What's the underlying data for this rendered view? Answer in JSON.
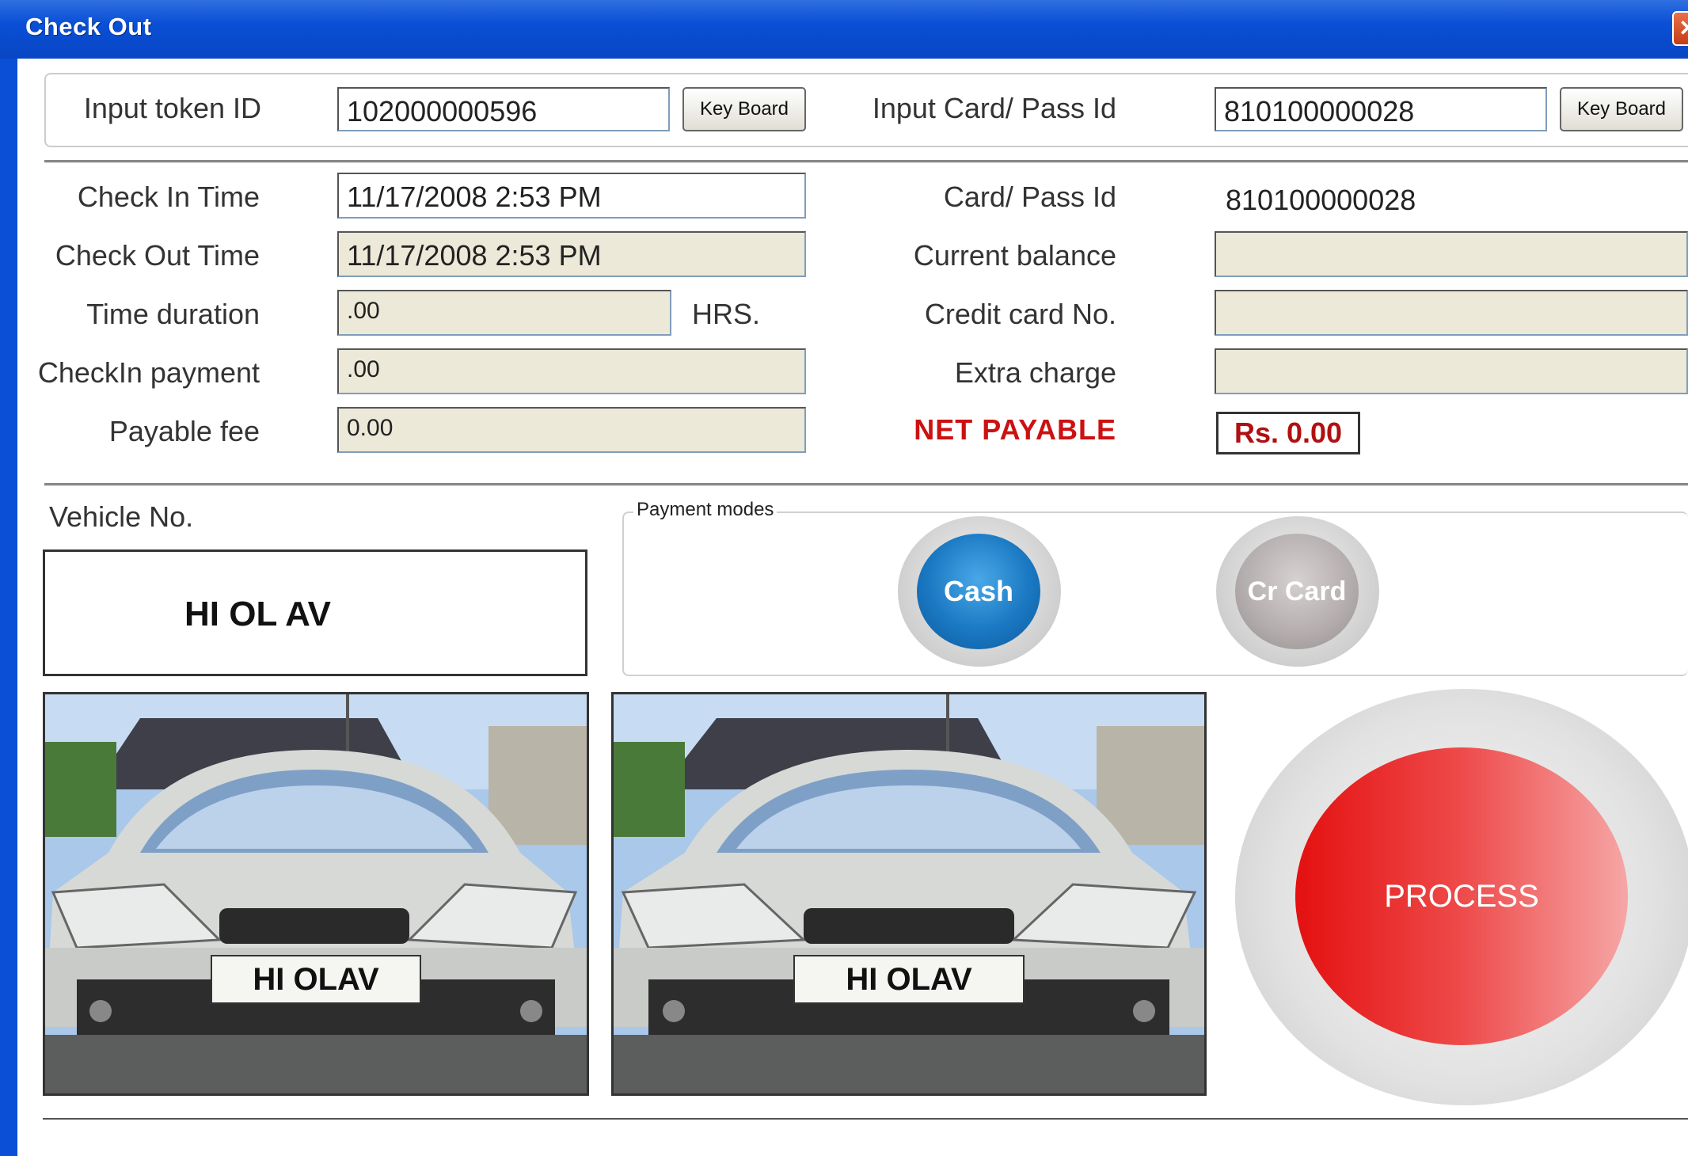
{
  "window": {
    "title": "Check Out",
    "close_glyph": "✕"
  },
  "top": {
    "token_label": "Input token ID",
    "token_value": "102000000596",
    "keyboard_label": "Key Board",
    "card_label": "Input Card/ Pass Id",
    "card_value": "810100000028",
    "keyboard2_label": "Key Board"
  },
  "details": {
    "checkin_time_label": "Check In Time",
    "checkin_time_value": "11/17/2008 2:53 PM",
    "checkout_time_label": "Check Out Time",
    "checkout_time_value": "11/17/2008 2:53 PM",
    "duration_label": "Time duration",
    "duration_value": ".00",
    "duration_unit": "HRS.",
    "checkin_payment_label": "CheckIn payment",
    "checkin_payment_value": ".00",
    "payable_fee_label": "Payable fee",
    "payable_fee_value": "0.00",
    "card_pass_label": "Card/ Pass Id",
    "card_pass_value": "810100000028",
    "current_balance_label": "Current balance",
    "current_balance_value": "",
    "credit_card_label": "Credit card No.",
    "credit_card_value": "",
    "extra_charge_label": "Extra charge",
    "extra_charge_value": "",
    "net_payable_label": "NET PAYABLE",
    "net_payable_value": "Rs. 0.00"
  },
  "vehicle": {
    "label": "Vehicle No.",
    "number": "HI OL AV",
    "plate_text_1": "HI OLAV",
    "plate_text_2": "HI OLAV"
  },
  "payment": {
    "group_title": "Payment modes",
    "cash_label": "Cash",
    "card_label": "Cr Card"
  },
  "process": {
    "label": "PROCESS"
  },
  "colors": {
    "title_bar": "#0a4fd6",
    "net_payable": "#cc1111",
    "cash_button": "#1a78c2",
    "card_button": "#b3acac",
    "process_button": "#e41010"
  }
}
